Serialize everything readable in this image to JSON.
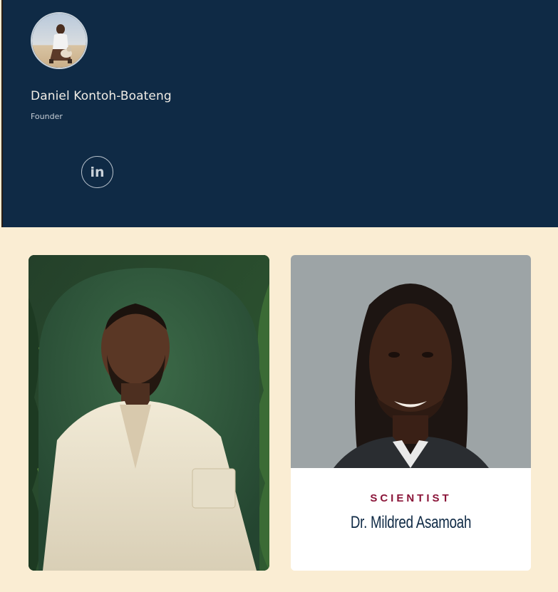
{
  "founder": {
    "name": "Daniel Kontoh-Boateng",
    "role": "Founder",
    "social": {
      "icon": "linkedin-icon",
      "label": "in"
    }
  },
  "team": [
    {
      "role": "",
      "name": ""
    },
    {
      "role": "SCIENTIST",
      "name": "Dr. Mildred Asamoah"
    }
  ],
  "colors": {
    "panel_bg": "#0f2a45",
    "page_bg": "#faedd3",
    "role_accent": "#8a1438",
    "name_text": "#0f2a45"
  }
}
